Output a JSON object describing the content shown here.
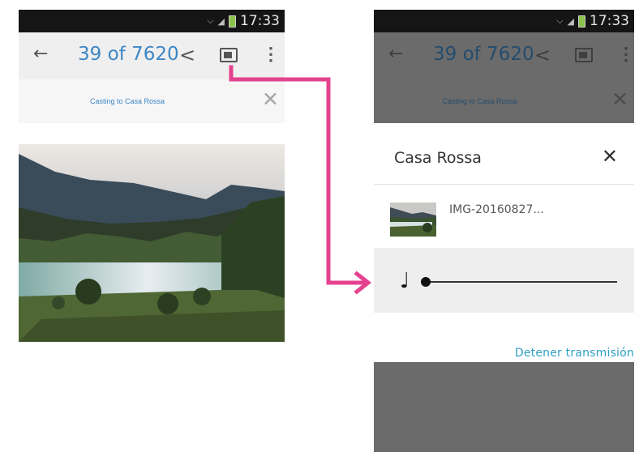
{
  "left_screen": {
    "status": {
      "time": "17:33",
      "icons": [
        "wifi-icon",
        "signal-icon",
        "battery-icon"
      ]
    },
    "toolbar": {
      "back_icon": "arrow-left-icon",
      "counter": "39 of 7620",
      "share_icon": "share-icon",
      "cast_icon": "cast-icon",
      "more_icon": "more-vertical-icon"
    },
    "cast_bar": {
      "text": "Casting to Casa Rossa",
      "close_icon": "close-icon"
    },
    "photo": {
      "description": "mountain lake landscape"
    }
  },
  "right_screen": {
    "status": {
      "time": "17:33"
    },
    "toolbar": {
      "counter": "39 of 7620"
    },
    "cast_bar": {
      "text": "Casting to Casa Rossa"
    },
    "dialog": {
      "title": "Casa Rossa",
      "close_icon": "close-icon",
      "media_name": "IMG-20160827...",
      "volume_icon": "music-note-icon",
      "volume_level": 0.0,
      "stop_casting_label": "Detener transmisión"
    }
  },
  "annotation": {
    "arrow_color": "#e4428f"
  },
  "colors": {
    "accent": "#3d86c6",
    "stop_link": "#2c9fc5",
    "overlay": "#6b6b6b"
  }
}
